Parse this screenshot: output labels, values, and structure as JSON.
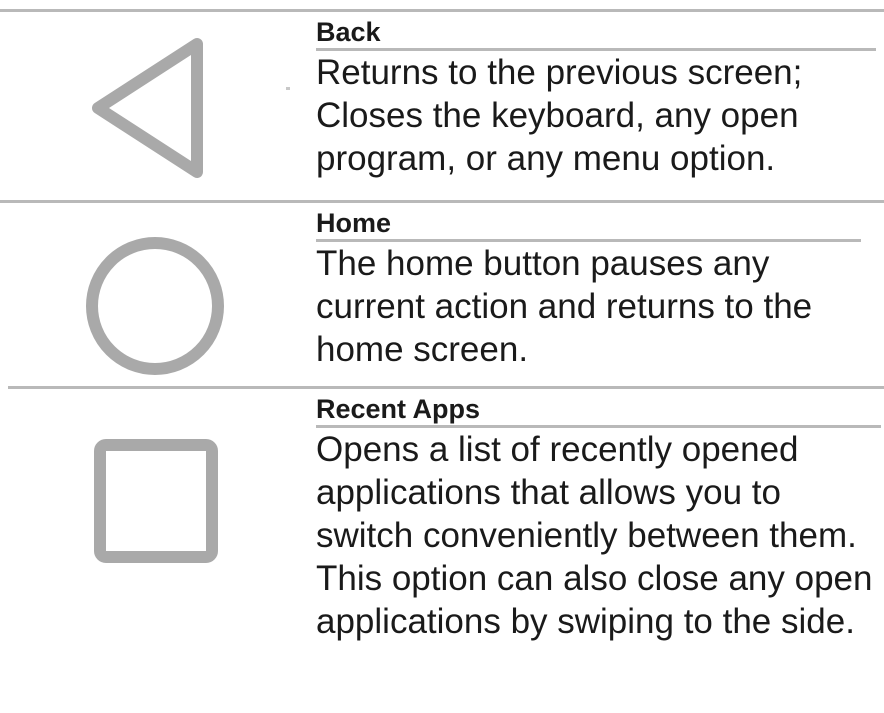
{
  "colors": {
    "icon_gray": "#a9a9a9",
    "rule_gray": "#b9b9b9",
    "text": "#1a1a1a"
  },
  "rows": [
    {
      "icon": "back-triangle-icon",
      "title": "Back",
      "description": "Returns to the previous screen; Closes the keyboard, any open program, or any menu option."
    },
    {
      "icon": "home-circle-icon",
      "title": "Home",
      "description": "The home button pauses any current action and returns to the home screen."
    },
    {
      "icon": "recent-apps-square-icon",
      "title": "Recent Apps",
      "description": "Opens a list of recently opened applications that allows you to switch conveniently between them. This option can also close any open applications by swiping to the side."
    }
  ]
}
